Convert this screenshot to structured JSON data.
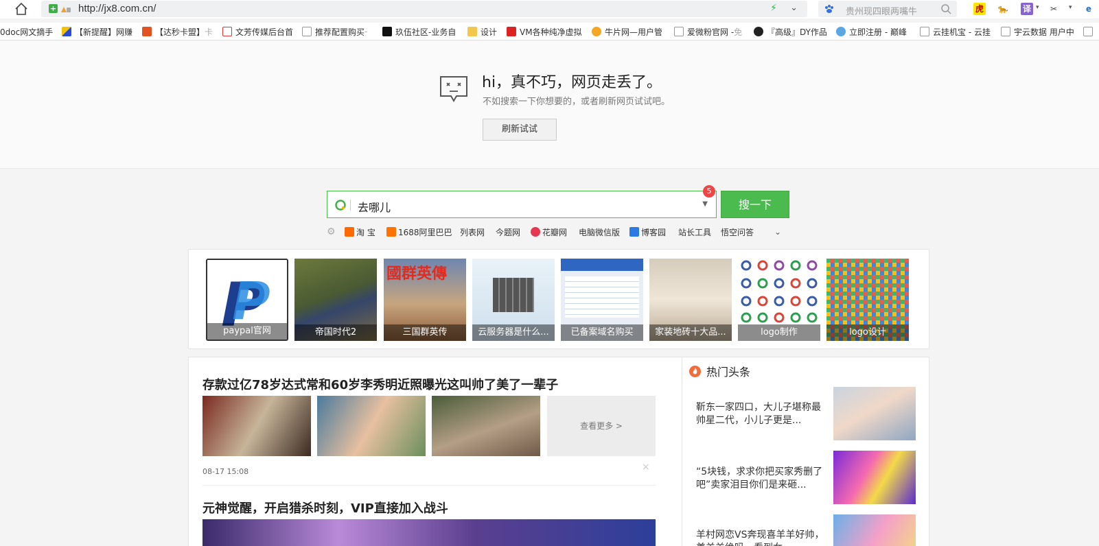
{
  "browser": {
    "url": "http://jx8.com.cn/",
    "search_placeholder": "贵州现四眼两嘴牛"
  },
  "extensions": {
    "hu": "虎",
    "yi": "译"
  },
  "bookmarks": [
    {
      "label": "0doc网文摘手",
      "fade": ""
    },
    {
      "label": "【新提醒】网赚",
      "fade": ""
    },
    {
      "label": "【达秒卡盟】",
      "fade": "卡"
    },
    {
      "label": "文芳传媒后台首",
      "fade": ""
    },
    {
      "label": "推荐配置购买",
      "fade": "-"
    },
    {
      "label": "玖伍社区-业务自",
      "fade": ""
    },
    {
      "label": "设计",
      "fade": ""
    },
    {
      "label": "VM各种纯净虚拟",
      "fade": ""
    },
    {
      "label": "牛片网—用户管",
      "fade": ""
    },
    {
      "label": "爱微粉官网 -",
      "fade": "免"
    },
    {
      "label": "『高级』DY作品",
      "fade": ""
    },
    {
      "label": "立即注册 - 巅峰",
      "fade": ""
    },
    {
      "label": "云挂机宝 - 云挂",
      "fade": ""
    },
    {
      "label": "宇云数据 用户中",
      "fade": ""
    }
  ],
  "error": {
    "title": "hi，真不巧，网页走丢了。",
    "subtitle": "不如搜索一下你想要的，或者刷新网页试试吧。",
    "refresh_label": "刷新试试"
  },
  "search": {
    "value": "去哪儿",
    "badge": "5",
    "button_label": "搜一下"
  },
  "quicklinks": [
    "淘 宝",
    "1688阿里巴巴",
    "列表网",
    "今题网",
    "花瓣网",
    "电脑微信版",
    "博客园",
    "站长工具",
    "悟空问答"
  ],
  "tiles": [
    "paypal官网",
    "帝国时代2",
    "三国群英传",
    "云服务器是什么...",
    "已备案域名购买",
    "家装地砖十大品...",
    "logo制作",
    "logo设计"
  ],
  "feed": {
    "article1_title": "存款过亿78岁达式常和60岁李秀明近照曝光这叫帅了美了一辈子",
    "more_label": "查看更多 >",
    "time": "08-17 15:08",
    "close": "×",
    "article2_title": "元神觉醒，开启猎杀时刻，VIP直接加入战斗"
  },
  "hot": {
    "title": "热门头条",
    "items": [
      "靳东一家四口，大儿子堪称最帅星二代，小儿子更是...",
      "“5块钱，求求你把买家秀删了吧”卖家泪目你们是来砸...",
      "羊村网恋VS奔现喜羊羊好帅，美羊羊绝吗，看到女..."
    ]
  }
}
